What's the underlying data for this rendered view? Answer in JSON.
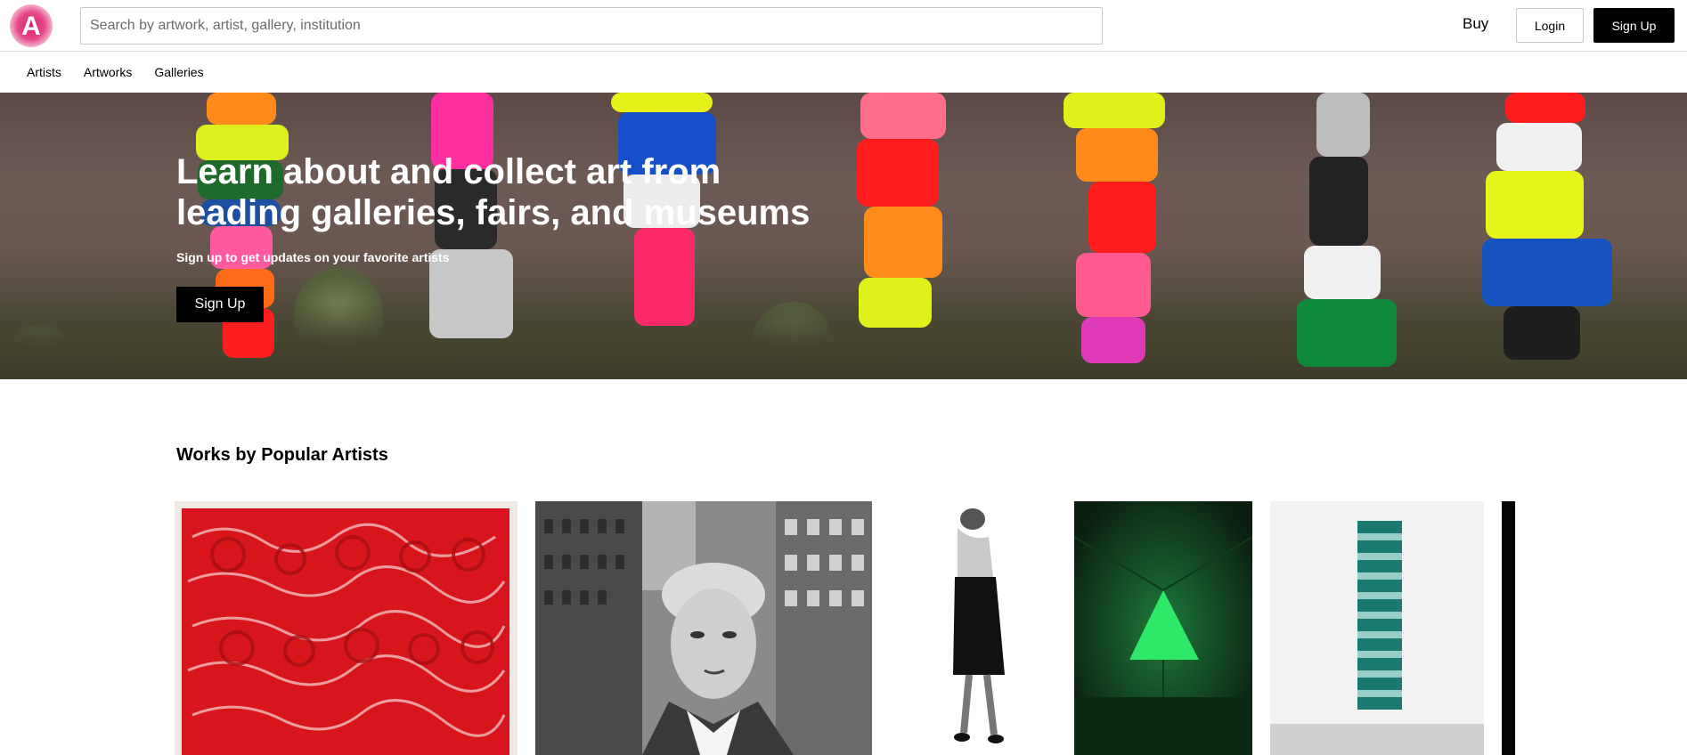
{
  "header": {
    "logo_letter": "A",
    "search_placeholder": "Search by artwork, artist, gallery, institution",
    "buy_label": "Buy",
    "login_label": "Login",
    "signup_label": "Sign Up"
  },
  "subnav": {
    "items": [
      "Artists",
      "Artworks",
      "Galleries"
    ]
  },
  "hero": {
    "title": "Learn about and collect art from leading galleries, fairs, and museums",
    "subtitle": "Sign up to get updates on your favorite artists",
    "button_label": "Sign Up"
  },
  "section": {
    "title": "Works by Popular Artists"
  },
  "colors": {
    "brand": "#d81e6c",
    "button_dark": "#000000"
  }
}
